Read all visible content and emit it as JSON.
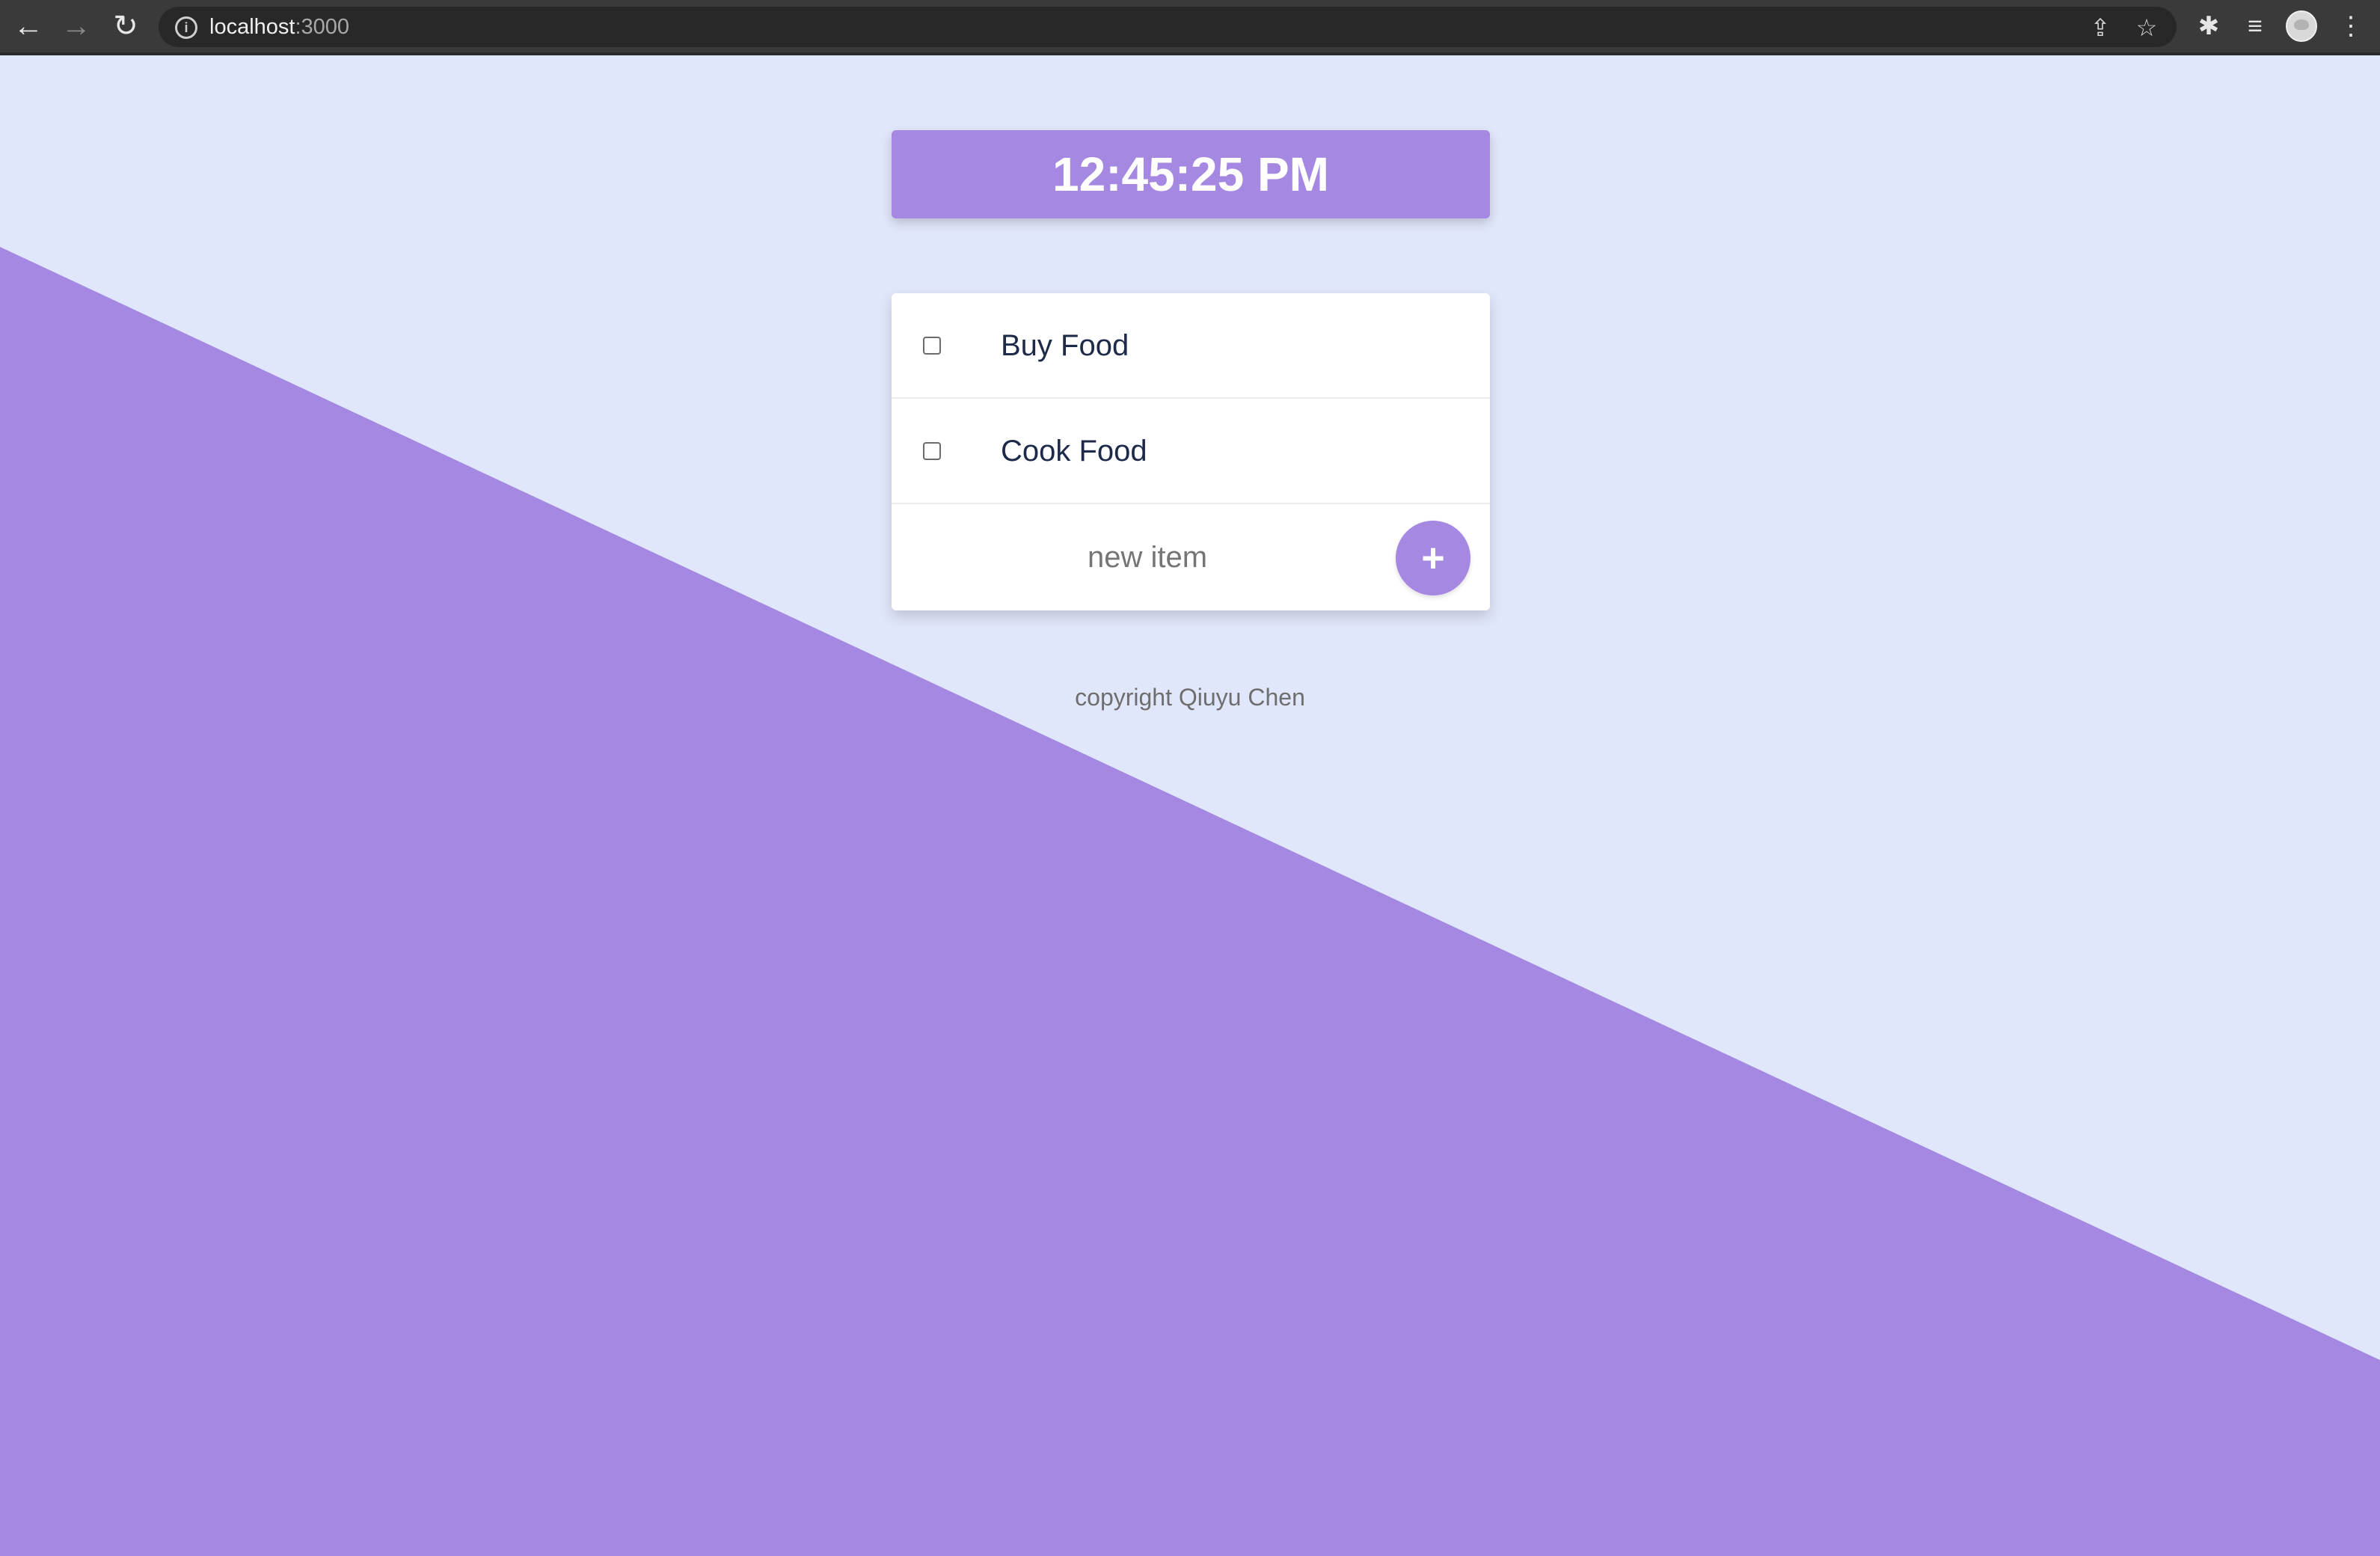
{
  "browser": {
    "back_icon": "←",
    "forward_icon": "→",
    "reload_icon": "↻",
    "url_host": "localhost",
    "url_port": ":3000",
    "share_icon": "⇪",
    "star_icon": "☆",
    "extensions_icon": "✱",
    "media_icon": "≡",
    "menu_icon": "⋮"
  },
  "app": {
    "clock_time": "12:45:25 PM",
    "items": [
      {
        "label": "Buy Food",
        "checked": false
      },
      {
        "label": "Cook Food",
        "checked": false
      }
    ],
    "new_item_placeholder": "new item",
    "add_button_label": "+",
    "footer_text": "copyright Qiuyu Chen"
  },
  "colors": {
    "accent": "#a488e2",
    "background": "#e1e7fa",
    "item_text": "#1e2a4a"
  }
}
